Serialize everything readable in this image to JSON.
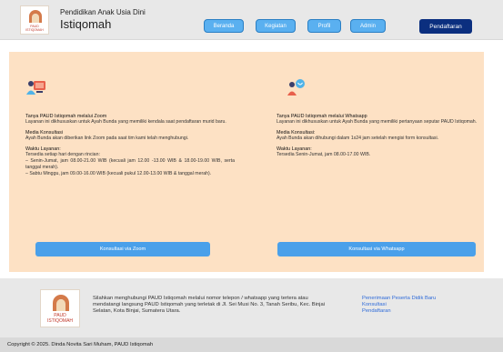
{
  "header": {
    "logo_text": "PAUD ISTIQOMAH",
    "subtitle": "Pendidikan Anak Usia Dini",
    "title": "Istiqomah",
    "nav": [
      "Beranda",
      "Kegiatan",
      "Profil",
      "Admin"
    ],
    "register_label": "Pendaftaran"
  },
  "zoom": {
    "title": "Tanya PAUD Istiqomah melalui Zoom",
    "intro": "Layanan ini dikhususkan untuk Ayah Bunda yang memiliki kendala saat pendaftaran murid baru.",
    "media_head": "Media Konsultasi",
    "media_text": "Ayah Bunda akan diberikan link Zoom pada saat tim kami telah menghubungi.",
    "time_head": "Waktu Layanan:",
    "time_line1": "Tersedia setiap hari dengan rincian:",
    "time_line2": "– Senin-Jumat, jam 08.00-21.00 WIB (kecuali jam 12.00 -13.00 WIB & 18.00-19.00 WIB, serta tanggal merah).",
    "time_line3": "– Sabtu Minggu, jam 09.00-16.00 WIB (kecuali pukul 12.00-13.00 WIB & tanggal merah).",
    "button": "Konsultasi via Zoom"
  },
  "whatsapp": {
    "title": "Tanya PAUD Istiqomah melalui Whatsapp",
    "intro": "Layanan ini dikhususkan untuk Ayah Bunda yang memiliki pertanyaan seputar PAUD Istiqomah.",
    "media_head": "Media Konsultasi:",
    "media_text": "Ayah Bunda akan dihubungi dalam 1x24 jam setelah mengisi form konsultasi.",
    "time_head": "Waktu Layanan:",
    "time_line1": "Tersedia Senin-Jumat, jam 08.00-17.00 WIB.",
    "button": "Konsultasi via Whatsapp"
  },
  "footer": {
    "logo_line1": "PAUD",
    "logo_line2": "ISTIQOMAH",
    "text": "Silahkan menghubungi PAUD Istiqomah melalui nomor telepon / whatsapp yang tertera atau mendatangi langsung PAUD Istiqomah yang terletak di Jl. Sei Musi No. 3, Tanah Seribu, Kec. Binjai Selatan, Kota Binjai, Sumatera Utara.",
    "links": [
      "Penerimaan Peserta Didik Baru",
      "Konsultasi",
      "Pendaftaran"
    ]
  },
  "copyright": "Copyright © 2025. Dinda Novita Sari Muham, PAUD Istiqomah",
  "colors": {
    "main_bg": "#fde1c4",
    "nav_button": "#5ab0f0",
    "register_button": "#0b2f7f",
    "cta_button": "#4aa0ea",
    "link": "#2f6bd9"
  }
}
